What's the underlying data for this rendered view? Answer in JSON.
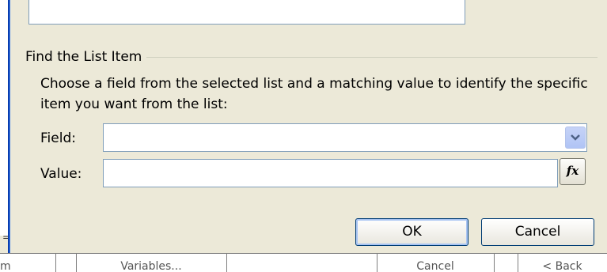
{
  "group": {
    "title": "Find the List Item",
    "description": "Choose a field from the selected list and a matching value to identify the specific item you want from the list:"
  },
  "fields": {
    "field_label": "Field:",
    "field_value": "",
    "value_label": "Value:",
    "value_value": "",
    "fx_label": "fx"
  },
  "buttons": {
    "ok": "OK",
    "cancel": "Cancel"
  },
  "background": {
    "cells": [
      "m",
      "",
      "Variables...",
      "",
      "Cancel",
      "",
      "< Back"
    ],
    "tick": "="
  },
  "colors": {
    "dialog_bg": "#ece9d8",
    "combo_button": "#c6d3f7",
    "focus_ring": "#a8c4f2"
  }
}
